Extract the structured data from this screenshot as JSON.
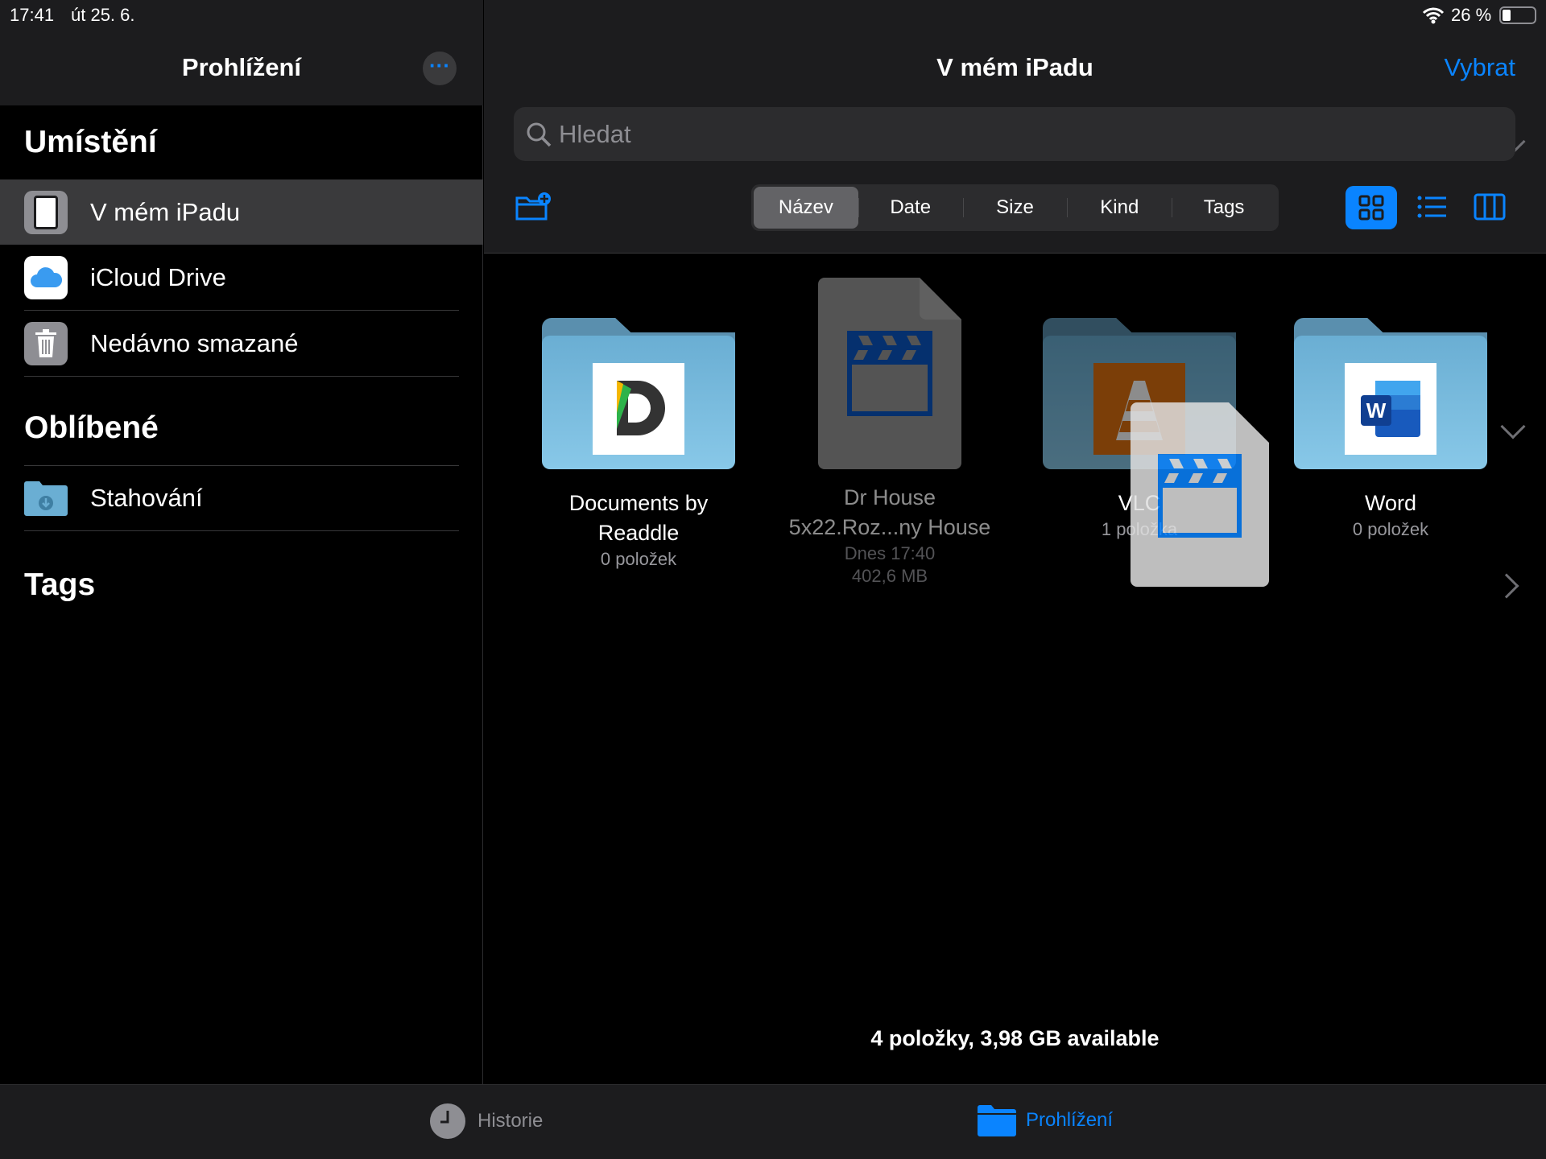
{
  "status": {
    "time": "17:41",
    "date": "út 25. 6.",
    "battery": "26 %",
    "battery_level": 0.26
  },
  "sidebar": {
    "title": "Prohlížení",
    "sections": [
      {
        "title": "Umístění",
        "items": [
          {
            "label": "V mém iPadu",
            "icon": "ipad-icon",
            "selected": true
          },
          {
            "label": "iCloud Drive",
            "icon": "icloud-icon"
          },
          {
            "label": "Nedávno smazané",
            "icon": "trash-icon"
          }
        ]
      },
      {
        "title": "Oblíbené",
        "items": [
          {
            "label": "Stahování",
            "icon": "downloads-folder-icon"
          }
        ]
      },
      {
        "title": "Tags"
      }
    ]
  },
  "main": {
    "title": "V mém iPadu",
    "select_label": "Vybrat",
    "search_placeholder": "Hledat",
    "sort_tabs": [
      "Název",
      "Date",
      "Size",
      "Kind",
      "Tags"
    ],
    "selected_sort": "Název",
    "view_mode": "grid",
    "items": [
      {
        "name1": "Documents by",
        "name2": "Readdle",
        "meta1": "0 položek",
        "type": "folder"
      },
      {
        "name1": "Dr House",
        "name2": "5x22.Roz...ny House",
        "meta1": "Dnes 17:40",
        "meta2": "402,6 MB",
        "type": "video"
      },
      {
        "name1": "VLC",
        "meta1": "1 položka",
        "type": "folder"
      },
      {
        "name1": "Word",
        "meta1": "0 položek",
        "type": "folder"
      }
    ],
    "footer": "4 položky, 3,98 GB available"
  },
  "tabbar": {
    "items": [
      {
        "label": "Historie",
        "icon": "clock-icon"
      },
      {
        "label": "Prohlížení",
        "icon": "folder-icon",
        "active": true
      }
    ]
  },
  "colors": {
    "accent": "#0a84ff",
    "selected_row": "#3a3a3c"
  }
}
